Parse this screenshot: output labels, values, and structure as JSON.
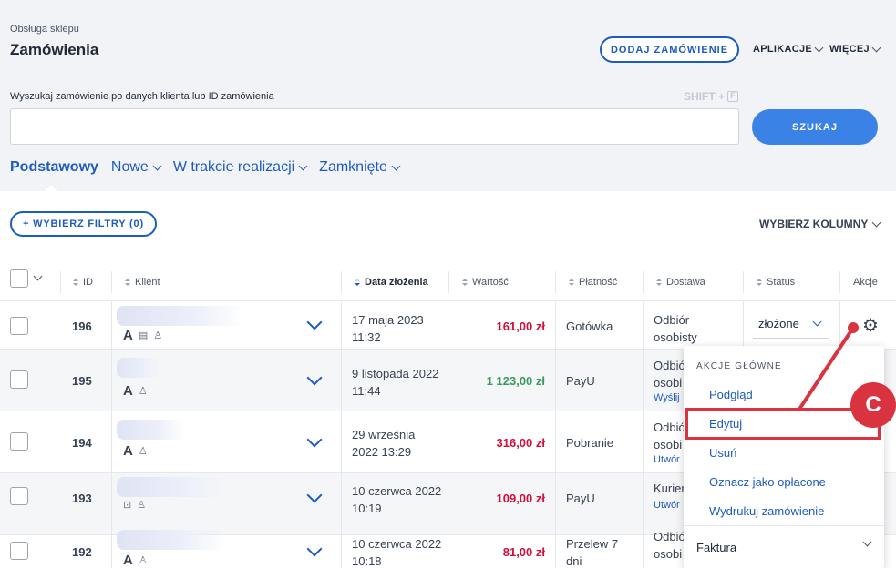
{
  "header": {
    "breadcrumb": "Obsługa sklepu",
    "title": "Zamówienia",
    "add_order_label": "DODAJ ZAMÓWIENIE",
    "apps_label": "APLIKACJE",
    "more_label": "WIĘCEJ"
  },
  "search": {
    "label": "Wyszukaj zamówienie po danych klienta lub ID zamówienia",
    "shortcut_text": "SHIFT +",
    "shortcut_key": "F",
    "value": "",
    "button_label": "SZUKAJ"
  },
  "tabs": [
    {
      "label": "Podstawowy"
    },
    {
      "label": "Nowe"
    },
    {
      "label": "W trakcie realizacji"
    },
    {
      "label": "Zamknięte"
    }
  ],
  "toolbar": {
    "filters_label": "+ WYBIERZ FILTRY (0)",
    "columns_label": "WYBIERZ KOLUMNY"
  },
  "table": {
    "columns": [
      "ID",
      "Klient",
      "Data złożenia",
      "Wartość",
      "Płatność",
      "Dostawa",
      "Status",
      "Akcje"
    ],
    "rows": [
      {
        "id": "196",
        "date_line1": "17 maja 2023",
        "date_line2": "11:32",
        "value": "161,00 zł",
        "payment": "Gotówka",
        "delivery_line1": "Odbiór",
        "delivery_line2": "osobisty",
        "status": "złożone"
      },
      {
        "id": "195",
        "date_line1": "9 listopada 2022",
        "date_line2": "11:44",
        "value": "1 123,00 zł",
        "payment": "PayU",
        "delivery_line1": "Odbió",
        "delivery_line2": "osobi",
        "delivery_link": "Wyślij"
      },
      {
        "id": "194",
        "date_line1": "29 września",
        "date_line2": "2022 13:29",
        "value": "316,00 zł",
        "payment": "Pobranie",
        "delivery_line1": "Odbió",
        "delivery_line2": "osobi",
        "delivery_link": "Utwór"
      },
      {
        "id": "193",
        "date_line1": "10 czerwca 2022",
        "date_line2": "10:19",
        "value": "109,00 zł",
        "payment": "PayU",
        "delivery_line1": "Kurier",
        "delivery_link": "Utwór"
      },
      {
        "id": "192",
        "date_line1": "10 czerwca 2022",
        "date_line2": "10:18",
        "value": "81,00 zł",
        "payment_line1": "Przelew 7",
        "payment_line2": "dni",
        "delivery_line1": "Odbió",
        "delivery_line2": "osobi"
      }
    ]
  },
  "actions_menu": {
    "heading": "AKCJE GŁÓWNE",
    "items": [
      "Podgląd",
      "Edytuj",
      "Usuń",
      "Oznacz jako opłacone",
      "Wydrukuj zamówienie"
    ],
    "invoice_label": "Faktura"
  },
  "annotation": {
    "callout_label": "C",
    "color": "#d9333f"
  }
}
